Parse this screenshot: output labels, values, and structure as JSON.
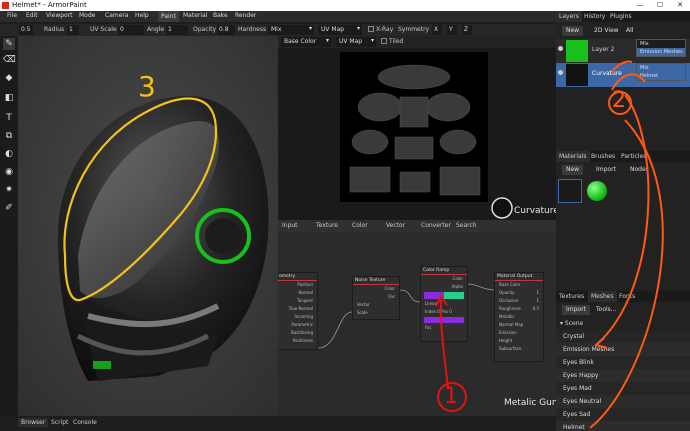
{
  "window": {
    "title": "Helmet* - ArmorPaint",
    "controls": [
      "—",
      "☐",
      "✕"
    ]
  },
  "menu": [
    "File",
    "Edit",
    "Viewport",
    "Mode",
    "Camera",
    "Help",
    "Paint",
    "Material",
    "Bake",
    "Render"
  ],
  "toolbar": {
    "brush_value": "0.5",
    "radius_label": "Radius",
    "radius_value": "1",
    "uvscale_label": "UV Scale",
    "uvscale_value": "0",
    "angle_label": "Angle",
    "angle_value": "1",
    "opacity_label": "Opacity",
    "opacity_value": "0.8",
    "hardness_label": "Hardness",
    "blend_value": "Mix",
    "mapping_value": "UV Map",
    "xray_label": "X-Ray",
    "symmetry_label": "Symmetry",
    "axes": [
      "X",
      "Y",
      "Z"
    ]
  },
  "left_tools": [
    {
      "icon": "brush-icon",
      "glyph": "✎"
    },
    {
      "icon": "eraser-icon",
      "glyph": "⌫"
    },
    {
      "icon": "fill-icon",
      "glyph": "◆"
    },
    {
      "icon": "decal-icon",
      "glyph": "◧"
    },
    {
      "icon": "text-icon",
      "glyph": "T"
    },
    {
      "icon": "clone-icon",
      "glyph": "⧉"
    },
    {
      "icon": "blur-icon",
      "glyph": "◐"
    },
    {
      "icon": "particle-icon",
      "glyph": "◉"
    },
    {
      "icon": "bake-icon",
      "glyph": "✷"
    },
    {
      "icon": "picker-icon",
      "glyph": "✐"
    }
  ],
  "view2d": {
    "channel_value": "Base Color",
    "uvmap_value": "UV Map",
    "tiled_label": "Tiled",
    "overlay_label": "Curvature"
  },
  "node_editor": {
    "menu": [
      "Input",
      "Texture",
      "Color",
      "Vector",
      "Converter",
      "Search"
    ],
    "overlay_label": "Metalic Gun",
    "geometry": {
      "title": "ometry",
      "rows": [
        "Position",
        "Normal",
        "Tangent",
        "True Normal",
        "Incoming",
        "Parametric",
        "Backfacing",
        "Pointiness"
      ]
    },
    "noise": {
      "title": "Noise Texture",
      "rows": [
        "Color",
        "Fac",
        "Vector",
        "Scale"
      ]
    },
    "ramp": {
      "title": "Color Ramp",
      "rows": [
        "Color",
        "Alpha",
        "Linear",
        "Index",
        "Pos",
        "Fac"
      ],
      "index": "0",
      "pos": "0"
    },
    "output": {
      "title": "Material Output",
      "rows": [
        "Base Color",
        "Opacity",
        "Occlusion",
        "Roughness",
        "Metallic",
        "Normal Map",
        "Emission",
        "Height",
        "Subsurface"
      ],
      "opacity": "1",
      "occlusion": "1",
      "roughness": "0.5"
    }
  },
  "bottom_tabs": [
    "Browser",
    "Script",
    "Console"
  ],
  "layers_panel": {
    "tabs": [
      "Layers",
      "History",
      "Plugins"
    ],
    "buttons": [
      "New",
      "2D View",
      "All"
    ],
    "layers": [
      {
        "name": "Layer 2"
      },
      {
        "name": "Curvature"
      }
    ],
    "popup1": [
      "Mix",
      "Emission Meshes"
    ],
    "popup2": [
      "Mix",
      "Helmet"
    ]
  },
  "materials_panel": {
    "tabs": [
      "Materials",
      "Brushes",
      "Particles"
    ],
    "buttons": [
      "New",
      "Import",
      "Nodes"
    ]
  },
  "meshes_panel": {
    "tabs": [
      "Textures",
      "Meshes",
      "Fonts"
    ],
    "buttons": [
      "Import",
      "Tools..."
    ],
    "scene_label": "Scene",
    "items": [
      "Crystal",
      "Emission Meshes",
      "Eyes Blink",
      "Eyes Happy",
      "Eyes Mad",
      "Eyes Neutral",
      "Eyes Sad",
      "Helmet"
    ]
  },
  "annotations": [
    "1",
    "2",
    "3"
  ],
  "colors": {
    "accent": "#3e67a8",
    "green": "#17c01a",
    "ink_orange": "#ff5a14",
    "ink_yellow": "#f2c21a",
    "ink_red": "#e01414"
  }
}
